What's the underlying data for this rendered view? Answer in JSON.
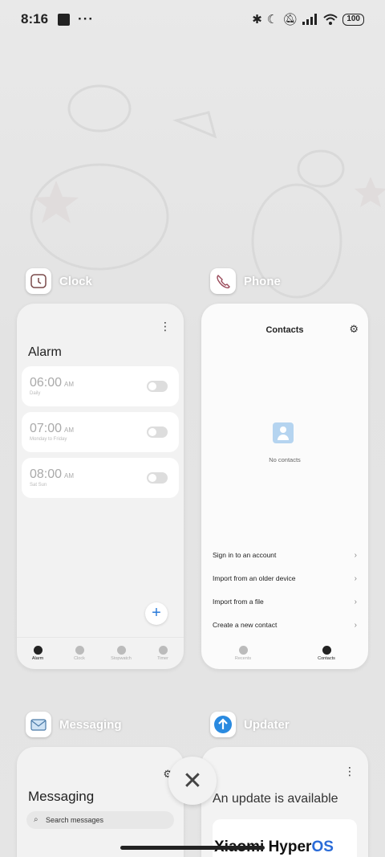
{
  "status_bar": {
    "time": "8:16",
    "battery": "100",
    "icons": [
      "notification-square-icon",
      "more-dots-icon",
      "bluetooth-icon",
      "do-not-disturb-moon-icon",
      "mute-bell-icon",
      "signal-icon",
      "wifi-icon",
      "battery-icon"
    ]
  },
  "apps": {
    "clock": {
      "label": "Clock",
      "screen": {
        "title": "Alarm",
        "alarms": [
          {
            "time": "06:00",
            "ampm": "AM",
            "repeat": "Daily"
          },
          {
            "time": "07:00",
            "ampm": "AM",
            "repeat": "Monday to Friday"
          },
          {
            "time": "08:00",
            "ampm": "AM",
            "repeat": "Sat Sun"
          }
        ],
        "fab": "+",
        "tabs": [
          "Alarm",
          "Clock",
          "Stopwatch",
          "Timer"
        ]
      }
    },
    "phone": {
      "label": "Phone",
      "screen": {
        "title": "Contacts",
        "empty_text": "No contacts",
        "options": [
          "Sign in to an account",
          "Import from an older device",
          "Import from a file",
          "Create a new contact"
        ],
        "tabs": [
          "Recents",
          "Contacts"
        ]
      }
    },
    "messaging": {
      "label": "Messaging",
      "screen": {
        "title": "Messaging",
        "search_placeholder": "Search messages"
      }
    },
    "updater": {
      "label": "Updater",
      "screen": {
        "title": "An update is available",
        "brand": "Xiaomi Hyper",
        "brand_os": "OS"
      }
    }
  },
  "close_all": "✕"
}
